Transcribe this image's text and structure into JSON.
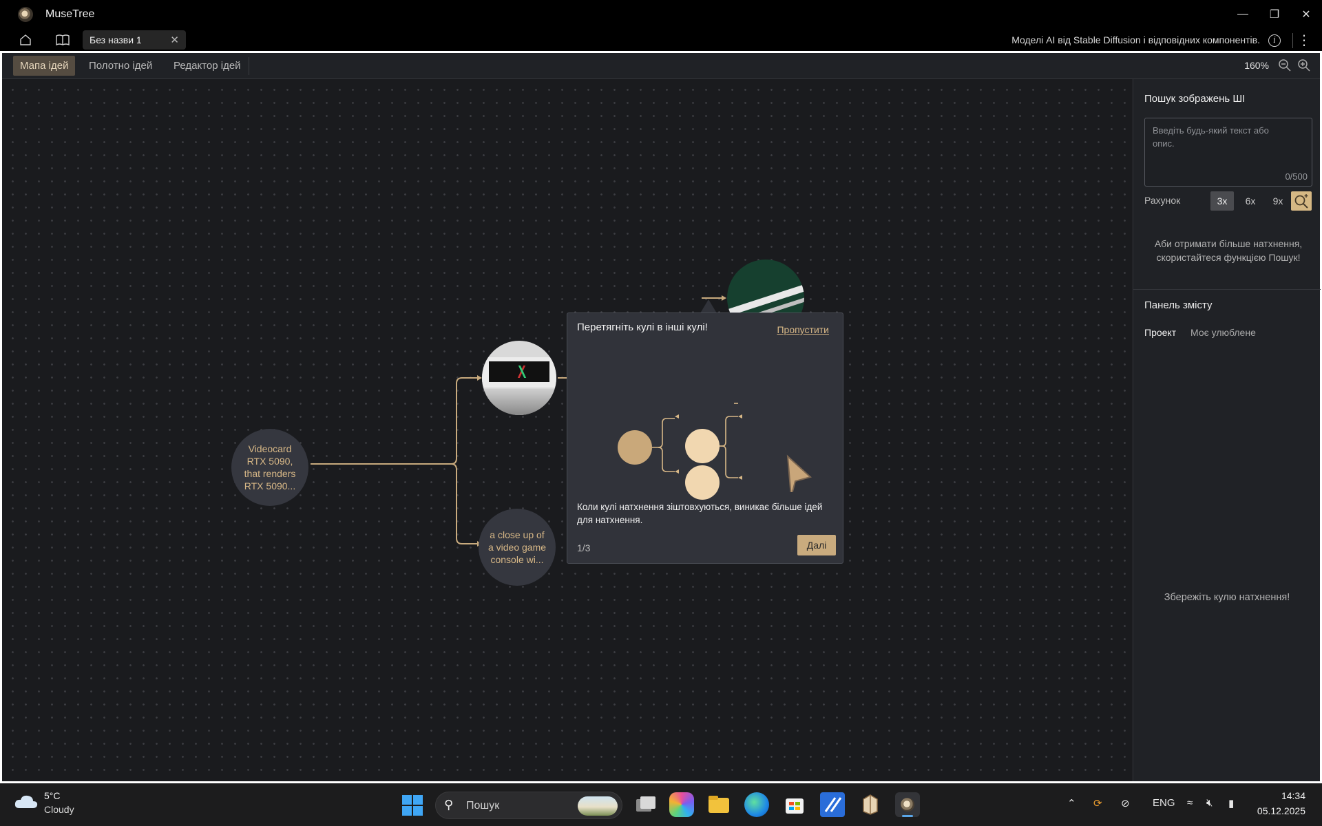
{
  "window": {
    "app_title": "MuseTree",
    "minimize": "—",
    "restore": "❐",
    "close": "✕"
  },
  "tabbar": {
    "home_icon": "home-icon",
    "book_icon": "book-icon",
    "doc_tab_label": "Без назви 1",
    "doc_tab_close": "✕",
    "model_note": "Моделі AI від Stable Diffusion і відповідних компонентів.",
    "info_glyph": "i",
    "menu_glyph": "⋮"
  },
  "toolbar": {
    "tabs": [
      {
        "label": "Мапа ідей",
        "active": true
      },
      {
        "label": "Полотно ідей",
        "active": false
      },
      {
        "label": "Редактор ідей",
        "active": false
      }
    ],
    "zoom": "160%"
  },
  "canvas": {
    "root_bubble": "Videocard RTX 5090, that renders RTX 5090...",
    "child_bubble": "a close up of a video game console wi...",
    "accent_color": "#c9ab7e"
  },
  "tour": {
    "title": "Перетягніть кулі в інші кулі!",
    "skip": "Пропустити",
    "description": "Коли кулі натхнення зіштовхуються, виникає більше ідей для натхнення.",
    "step": "1/3",
    "next": "Далі"
  },
  "panel": {
    "search_title": "Пошук зображень ШІ",
    "search_placeholder": "Введіть будь-який текст або опис.",
    "counter": "0/500",
    "count_label": "Рахунок",
    "count_options": [
      "3x",
      "6x",
      "9x"
    ],
    "selected_count": "3x",
    "hint": "Аби отримати більше натхнення, скористайтеся функцією Пошук!",
    "content_title": "Панель змісту",
    "content_tabs": [
      {
        "label": "Проект",
        "active": true
      },
      {
        "label": "Моє улюблене",
        "active": false
      }
    ],
    "empty_hint": "Збережіть кулю натхнення!"
  },
  "taskbar": {
    "temperature": "5°C",
    "condition": "Cloudy",
    "search_label": "Пошук",
    "lang": "ENG",
    "time": "14:34",
    "date": "05.12.2025"
  }
}
